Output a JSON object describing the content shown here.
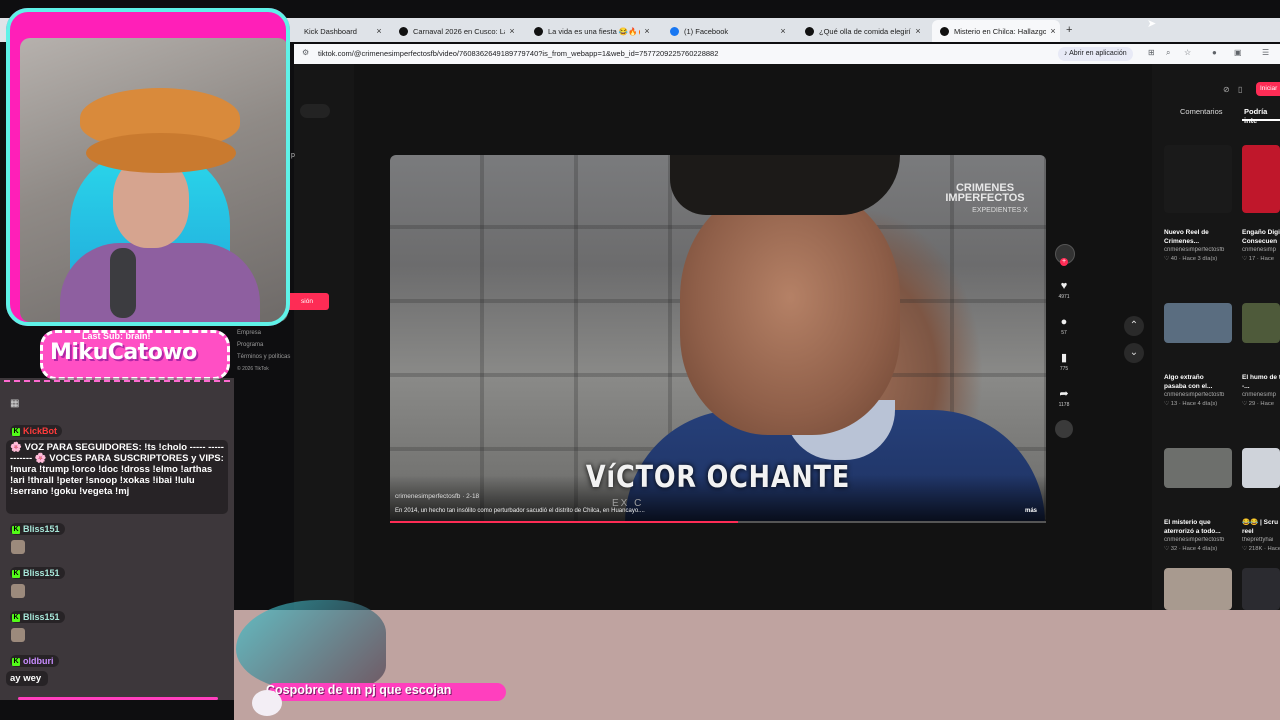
{
  "browser": {
    "tabs": [
      {
        "label": "Kick Dashboard",
        "icon": "kick"
      },
      {
        "label": "Carnaval 2026 en Cusco: La Fie",
        "icon": "tiktok"
      },
      {
        "label": "La vida es una fiesta 😂🔥🔥😂",
        "icon": "tiktok"
      },
      {
        "label": "(1) Facebook",
        "icon": "facebook"
      },
      {
        "label": "¿Qué olla de comida elegirías c",
        "icon": "tiktok"
      },
      {
        "label": "Misterio en Chilca: Hallazgo",
        "icon": "tiktok",
        "active": true
      }
    ],
    "url": "tiktok.com/@crimenesimperfectosfb/video/7608362649189779740?is_from_webapp=1&web_id=7577209225760228882",
    "open_app_label": "Abrir en aplicación",
    "new_tab": "+"
  },
  "tiktok": {
    "left_menu": [
      "Empresa",
      "Programa",
      "Términos y políticas",
      "© 2026 TikTok"
    ],
    "left_login": "sión",
    "left_partial": "p",
    "video": {
      "overlay_name": "VíCTOR OCHANTE",
      "overlay_sub": "EX C",
      "brand_line1": "CRIMENES",
      "brand_line2": "IMPERFECTOS",
      "brand_line3": "EXPEDIENTES X",
      "author": "crimenesimperfectosfb · 2-18",
      "caption": "En 2014, un hecho tan insólito como perturbador sacudió el distrito de Chilca, en Huancayo....",
      "more": "más",
      "progress_fraction": 0.53
    },
    "actions": {
      "likes": "4971",
      "comments": "57",
      "saves": "775",
      "shares": "1178"
    },
    "right_tabs": {
      "comments": "Comentarios",
      "podria": "Podría inte"
    },
    "login": "Iniciar",
    "recommended": [
      {
        "title": "Nuevo Reel de Crimenes...",
        "author": "crimenesimperfectosfb",
        "meta": "♡ 40 · Hace 3 día(s)"
      },
      {
        "title": "Engaño Digi Consecuen",
        "author": "crimenesimp",
        "meta": "♡ 17 · Hace"
      },
      {
        "title": "Algo extraño pasaba con el...",
        "author": "crimenesimperfectosfb",
        "meta": "♡ 13 · Hace 4 día(s)"
      },
      {
        "title": "El humo de traición -...",
        "author": "crimenesimp",
        "meta": "♡ 29 · Hace"
      },
      {
        "title": "El misterio que aterrorizó a todo...",
        "author": "crimenesimperfectosfb",
        "meta": "♡ 32 · Hace 4 día(s)"
      },
      {
        "title": "😂😂 | Scru badge reel",
        "author": "theprettyhai",
        "meta": "♡ 218K · Hace"
      }
    ]
  },
  "overlay": {
    "channel": "MikuCatowo",
    "last_sub": "Last Sub: brain!",
    "chat": [
      {
        "user": "KickBot",
        "color": "#ff3b3b",
        "text": "🌸 VOZ PARA SEGUIDORES: !ts !cholo ----- ------------ 🌸 VOCES PARA SUSCRIPTORES y VIPS: !mura !trump !orco !doc !dross !elmo !arthas !ari !thrall !peter !snoop !xokas !ibai !lulu !serrano !goku !vegeta !mj"
      },
      {
        "user": "Bliss151",
        "color": "#a6e6d8",
        "text": ""
      },
      {
        "user": "Bliss151",
        "color": "#a6e6d8",
        "text": ""
      },
      {
        "user": "Bliss151",
        "color": "#a6e6d8",
        "text": ""
      },
      {
        "user": "oldburi",
        "color": "#c88cff",
        "text": "ay wey"
      }
    ],
    "ticker": "Cospobre de un pj que escojan",
    "colors": {
      "accent": "#ff1fb8",
      "teal": "#5ff2e8",
      "kick_green": "#53fc18",
      "tiktok_red": "#fe2c55"
    }
  }
}
